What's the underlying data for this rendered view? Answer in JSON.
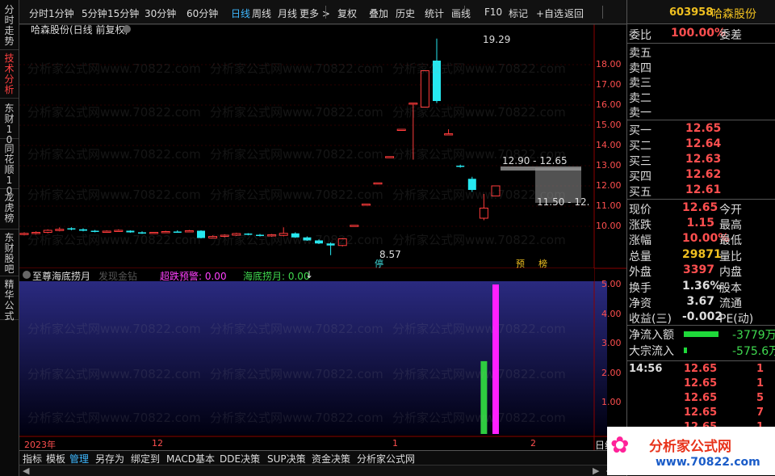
{
  "vertical_tabs": [
    "分时走势",
    "技术分析",
    "东财10",
    "同花顺10",
    "龙虎榜",
    "东财股吧",
    "精华公式"
  ],
  "toolbar": [
    "分时",
    "1分钟",
    "5分钟",
    "15分钟",
    "30分钟",
    "60分钟",
    "日线",
    "周线",
    "月线",
    "更多 >",
    "复权",
    "叠加",
    "历史",
    "统计",
    "画线",
    "F10",
    "标记",
    "+自选",
    "返回"
  ],
  "toolbar_active": "日线",
  "chart_title": "哈森股份(日线 前复权)",
  "price_axis": [
    "18.00",
    "17.00",
    "16.00",
    "15.00",
    "14.00",
    "13.00",
    "12.00",
    "11.00",
    "10.00"
  ],
  "annotations": {
    "high": "19.29",
    "range1": "12.90 - 12.65",
    "range2": "11.50 - 12.",
    "low": "8.57",
    "tag_stop": "停",
    "tag_pre": "预",
    "tag_list": "榜"
  },
  "indicator": {
    "name": "至尊海底捞月",
    "hint": "发现金钻",
    "warn_label": "超跌预警: 0.00",
    "fish_label": "海底捞月: 0.00",
    "fish_arrow": "↓"
  },
  "indicator_axis": [
    "5.00",
    "4.00",
    "3.00",
    "2.00",
    "1.00"
  ],
  "date_axis": {
    "year": "2023年",
    "m12": "12",
    "m1": "1",
    "m2": "2",
    "day": "日线"
  },
  "bottom_tabs": [
    "指标",
    "模板",
    "管理",
    "另存为",
    "绑定到",
    "MACD基本",
    "DDE决策",
    "SUP决策",
    "资金决策",
    "分析家公式网"
  ],
  "bottom_active": "管理",
  "watermark": "分析家公式网www.70822.com",
  "stock": {
    "code": "603958",
    "name": "哈森股份"
  },
  "commission": {
    "label": "委比",
    "value": "100.00%",
    "diff_label": "委差"
  },
  "sell": [
    {
      "label": "卖五"
    },
    {
      "label": "卖四"
    },
    {
      "label": "卖三"
    },
    {
      "label": "卖二"
    },
    {
      "label": "卖一"
    }
  ],
  "buy": [
    {
      "label": "买一",
      "price": "12.65"
    },
    {
      "label": "买二",
      "price": "12.64"
    },
    {
      "label": "买三",
      "price": "12.63"
    },
    {
      "label": "买四",
      "price": "12.62"
    },
    {
      "label": "买五",
      "price": "12.61"
    }
  ],
  "stats": [
    {
      "l1": "现价",
      "v1": "12.65",
      "c1": "red",
      "l2": "今开"
    },
    {
      "l1": "涨跌",
      "v1": "1.15",
      "c1": "red",
      "l2": "最高"
    },
    {
      "l1": "涨幅",
      "v1": "10.00%",
      "c1": "red",
      "l2": "最低"
    },
    {
      "l1": "总量",
      "v1": "29871",
      "c1": "yellow",
      "l2": "量比"
    },
    {
      "l1": "外盘",
      "v1": "3397",
      "c1": "red",
      "l2": "内盘"
    },
    {
      "l1": "换手",
      "v1": "1.36%",
      "c1": "w",
      "l2": "股本"
    },
    {
      "l1": "净资",
      "v1": "3.67",
      "c1": "w",
      "l2": "流通"
    },
    {
      "l1": "收益(三)",
      "v1": "-0.002",
      "c1": "w",
      "l2": "PE(动)"
    }
  ],
  "flows": [
    {
      "label": "净流入额",
      "value": "-3779万",
      "bar": 0.62
    },
    {
      "label": "大宗流入",
      "value": "-575.6万",
      "bar": 0.05
    }
  ],
  "ticks": [
    {
      "time": "14:56",
      "price": "12.65",
      "vol": "1"
    },
    {
      "time": "",
      "price": "12.65",
      "vol": "1"
    },
    {
      "time": "",
      "price": "12.65",
      "vol": "5"
    },
    {
      "time": "",
      "price": "12.65",
      "vol": "7"
    },
    {
      "time": "",
      "price": "12.65",
      "vol": "1"
    }
  ],
  "logo": {
    "text": "分析家公式网",
    "url": "www.70822.com"
  },
  "candles": [
    {
      "o": 9.6,
      "h": 9.7,
      "l": 9.55,
      "c": 9.65
    },
    {
      "o": 9.65,
      "h": 9.75,
      "l": 9.6,
      "c": 9.7
    },
    {
      "o": 9.7,
      "h": 9.85,
      "l": 9.65,
      "c": 9.8
    },
    {
      "o": 9.8,
      "h": 9.95,
      "l": 9.75,
      "c": 9.85
    },
    {
      "o": 9.9,
      "h": 9.95,
      "l": 9.8,
      "c": 9.85
    },
    {
      "o": 9.85,
      "h": 9.9,
      "l": 9.75,
      "c": 9.78
    },
    {
      "o": 9.78,
      "h": 9.82,
      "l": 9.7,
      "c": 9.72
    },
    {
      "o": 9.72,
      "h": 9.8,
      "l": 9.7,
      "c": 9.76
    },
    {
      "o": 9.76,
      "h": 9.85,
      "l": 9.72,
      "c": 9.8
    },
    {
      "o": 9.78,
      "h": 9.8,
      "l": 9.68,
      "c": 9.7
    },
    {
      "o": 9.7,
      "h": 9.75,
      "l": 9.62,
      "c": 9.66
    },
    {
      "o": 9.66,
      "h": 9.72,
      "l": 9.62,
      "c": 9.7
    },
    {
      "o": 9.7,
      "h": 9.78,
      "l": 9.66,
      "c": 9.74
    },
    {
      "o": 9.74,
      "h": 9.8,
      "l": 9.7,
      "c": 9.72
    },
    {
      "o": 9.72,
      "h": 9.82,
      "l": 9.7,
      "c": 9.78
    },
    {
      "o": 9.78,
      "h": 9.8,
      "l": 9.4,
      "c": 9.42
    },
    {
      "o": 9.42,
      "h": 9.55,
      "l": 9.4,
      "c": 9.5
    },
    {
      "o": 9.5,
      "h": 9.6,
      "l": 9.45,
      "c": 9.56
    },
    {
      "o": 9.56,
      "h": 9.68,
      "l": 9.52,
      "c": 9.64
    },
    {
      "o": 9.64,
      "h": 9.66,
      "l": 9.55,
      "c": 9.58
    },
    {
      "o": 9.58,
      "h": 9.62,
      "l": 9.5,
      "c": 9.52
    },
    {
      "o": 9.52,
      "h": 9.62,
      "l": 9.48,
      "c": 9.58
    },
    {
      "o": 9.55,
      "h": 9.95,
      "l": 9.5,
      "c": 9.65
    },
    {
      "o": 9.65,
      "h": 9.7,
      "l": 9.42,
      "c": 9.45
    },
    {
      "o": 9.45,
      "h": 9.5,
      "l": 9.28,
      "c": 9.3
    },
    {
      "o": 9.3,
      "h": 9.35,
      "l": 9.12,
      "c": 9.15
    },
    {
      "o": 9.15,
      "h": 9.2,
      "l": 8.57,
      "c": 9.05
    },
    {
      "o": 9.05,
      "h": 9.42,
      "l": 9.0,
      "c": 9.38
    },
    {
      "o": 10.0,
      "h": 10.05,
      "l": 10.0,
      "c": 10.05
    },
    {
      "o": 11.05,
      "h": 11.1,
      "l": 11.05,
      "c": 11.1
    },
    {
      "o": 12.1,
      "h": 12.15,
      "l": 12.1,
      "c": 12.15
    },
    {
      "o": 13.4,
      "h": 13.45,
      "l": 13.4,
      "c": 13.45
    },
    {
      "o": 14.8,
      "h": 14.82,
      "l": 14.78,
      "c": 14.8
    },
    {
      "o": 16.1,
      "h": 16.12,
      "l": 13.3,
      "c": 16.1
    },
    {
      "o": 15.9,
      "h": 17.7,
      "l": 15.9,
      "c": 17.7
    },
    {
      "o": 18.2,
      "h": 19.29,
      "l": 16.1,
      "c": 16.2
    },
    {
      "o": 14.55,
      "h": 14.8,
      "l": 14.55,
      "c": 14.58
    },
    {
      "o": 13.0,
      "h": 13.05,
      "l": 12.9,
      "c": 12.95
    },
    {
      "o": 12.35,
      "h": 12.45,
      "l": 11.7,
      "c": 11.8
    },
    {
      "o": 10.4,
      "h": 11.6,
      "l": 10.3,
      "c": 10.9
    },
    {
      "o": 11.5,
      "h": 12.0,
      "l": 11.5,
      "c": 12.0
    }
  ],
  "volumes": [
    {
      "i": 39,
      "v": 2.4,
      "color": "#2ecc40"
    },
    {
      "i": 40,
      "v": 5.0,
      "color": "#ff20ff"
    }
  ]
}
